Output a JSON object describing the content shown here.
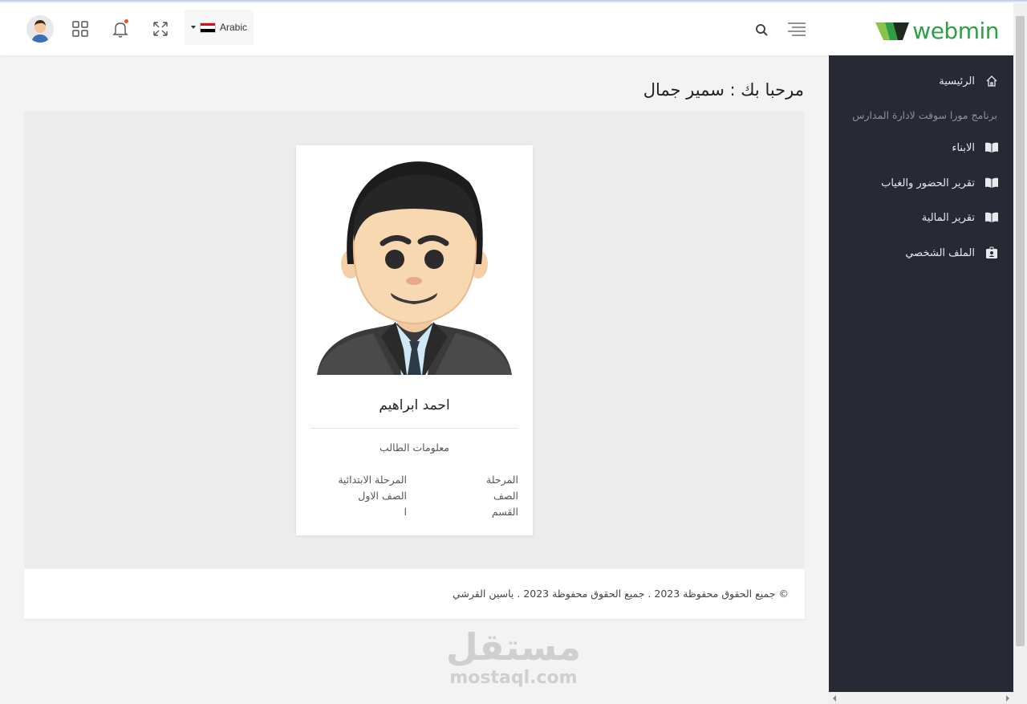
{
  "header": {
    "logo_text": "webmin",
    "language": {
      "label": "Arabic",
      "flag_colors": [
        "#ce1126",
        "#ffffff",
        "#000000"
      ]
    },
    "icons": [
      "menu-icon",
      "search-icon",
      "language-flag-icon",
      "fullscreen-icon",
      "bell-icon",
      "apps-grid-icon",
      "user-avatar-icon"
    ],
    "notification_dot_color": "#e8541e"
  },
  "sidebar": {
    "items": [
      {
        "label": "الرئيسية",
        "icon": "home-icon"
      },
      {
        "label": "الابناء",
        "icon": "book-icon"
      },
      {
        "label": "تقرير الحضور والغياب",
        "icon": "book-icon"
      },
      {
        "label": "تقرير المالية",
        "icon": "book-icon"
      },
      {
        "label": "الملف الشخصي",
        "icon": "id-badge-icon"
      }
    ],
    "subtitle": "برنامج مورا سوفت لادارة المدارس"
  },
  "main": {
    "welcome": "مرحبا بك : سمير جمال",
    "card": {
      "name": "احمد ابراهيم",
      "section_title": "معلومات الطالب",
      "rows": [
        {
          "key": "المرحلة",
          "value": "المرحلة الابتدائية"
        },
        {
          "key": "الصف",
          "value": "الصف الاول"
        },
        {
          "key": "القسم",
          "value": "ا"
        }
      ]
    }
  },
  "footer": {
    "text": "© جميع الحقوق محفوظة 2023 . جميع الحقوق محفوظة 2023 . ياسين القرشي"
  },
  "watermark": {
    "arabic": "مستقل",
    "latin": "mostaql.com"
  },
  "colors": {
    "sidebar_bg": "#272935",
    "logo_green": "#2f9e44",
    "panel_bg": "#ececec"
  }
}
